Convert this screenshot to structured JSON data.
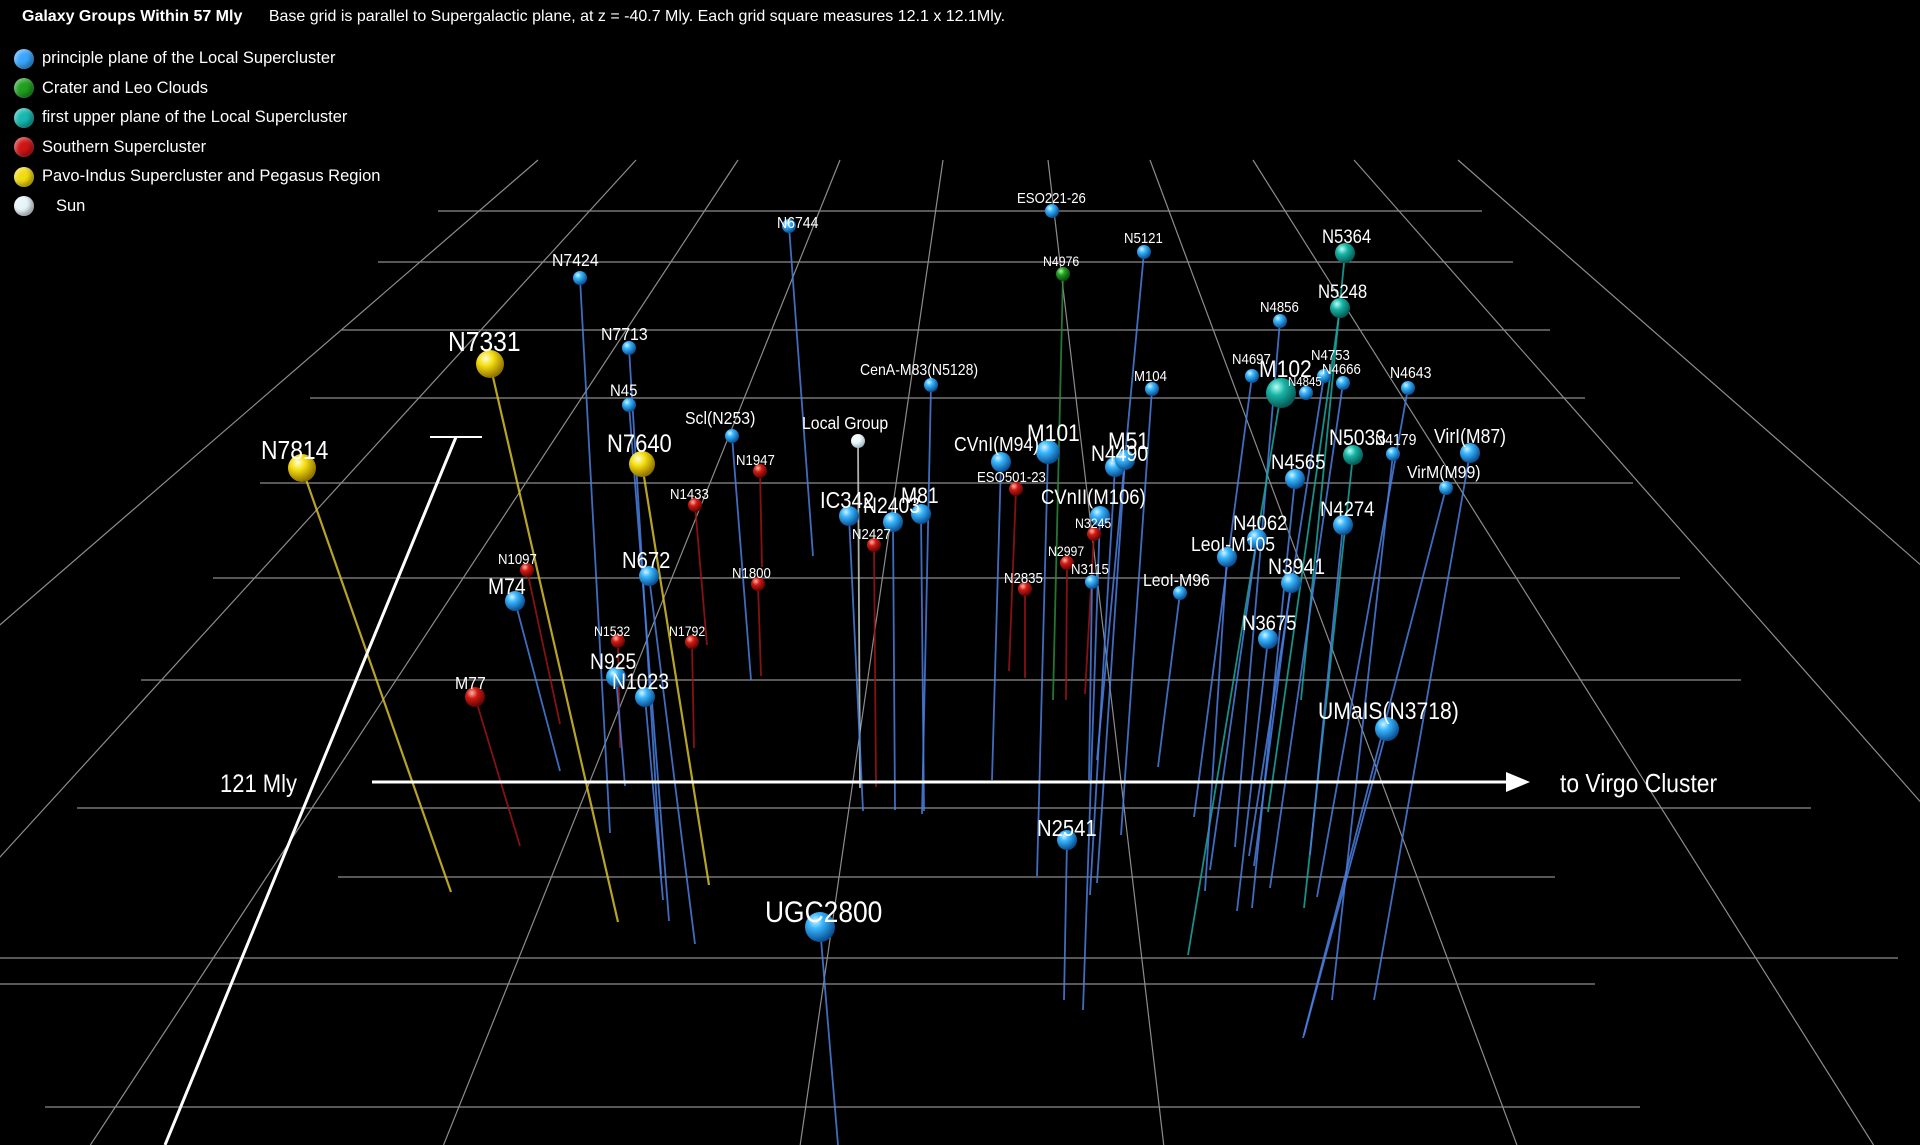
{
  "header": {
    "title": "Galaxy Groups Within 57 Mly",
    "subtitle": "Base grid is parallel to Supergalactic plane, at z = -40.7 Mly. Each grid square measures 12.1 x 12.1Mly."
  },
  "legend": [
    {
      "label": "principle plane of the Local Supercluster",
      "color": "#3aa6ff"
    },
    {
      "label": "Crater and Leo Clouds",
      "color": "#1fa11f"
    },
    {
      "label": "first upper plane of the Local Supercluster",
      "color": "#16b8b0"
    },
    {
      "label": "Southern Supercluster",
      "color": "#d01515"
    },
    {
      "label": "Pavo-Indus Supercluster and Pegasus Region",
      "color": "#f2dc10"
    },
    {
      "label": "Sun",
      "color": "#e8f6fb"
    }
  ],
  "axes": {
    "scale_label": "121 Mly",
    "direction_label": "to Virgo Cluster"
  },
  "galaxies": [
    {
      "name": "N6744",
      "type": "principle",
      "size": "small"
    },
    {
      "name": "ESO221-26",
      "type": "principle",
      "size": "small"
    },
    {
      "name": "N5121",
      "type": "principle",
      "size": "small"
    },
    {
      "name": "N5364",
      "type": "upper",
      "size": "medium"
    },
    {
      "name": "N4976",
      "type": "crater",
      "size": "small"
    },
    {
      "name": "N7424",
      "type": "principle",
      "size": "small"
    },
    {
      "name": "N5248",
      "type": "upper",
      "size": "medium"
    },
    {
      "name": "N4856",
      "type": "principle",
      "size": "small"
    },
    {
      "name": "N7713",
      "type": "principle",
      "size": "small"
    },
    {
      "name": "N7331",
      "type": "pavo",
      "size": "large"
    },
    {
      "name": "CenA-M83(N5128)",
      "type": "principle",
      "size": "small"
    },
    {
      "name": "N4697",
      "type": "principle",
      "size": "small"
    },
    {
      "name": "M102",
      "type": "upper",
      "size": "large"
    },
    {
      "name": "N4753",
      "type": "principle",
      "size": "small"
    },
    {
      "name": "N4643",
      "type": "principle",
      "size": "small"
    },
    {
      "name": "M104",
      "type": "principle",
      "size": "small"
    },
    {
      "name": "N45",
      "type": "principle",
      "size": "small"
    },
    {
      "name": "N4666",
      "type": "principle",
      "size": "small"
    },
    {
      "name": "N4845",
      "type": "principle",
      "size": "small"
    },
    {
      "name": "Scl(N253)",
      "type": "principle",
      "size": "small"
    },
    {
      "name": "Local Group",
      "type": "sun",
      "size": "small"
    },
    {
      "name": "N7814",
      "type": "pavo",
      "size": "large"
    },
    {
      "name": "N7640",
      "type": "pavo",
      "size": "large"
    },
    {
      "name": "CVnI(M94)",
      "type": "principle",
      "size": "medium"
    },
    {
      "name": "M101",
      "type": "principle",
      "size": "medium"
    },
    {
      "name": "N4490",
      "type": "principle",
      "size": "medium"
    },
    {
      "name": "M51",
      "type": "principle",
      "size": "medium"
    },
    {
      "name": "N5033",
      "type": "upper",
      "size": "medium"
    },
    {
      "name": "N4179",
      "type": "principle",
      "size": "small"
    },
    {
      "name": "VirI(M87)",
      "type": "principle",
      "size": "medium"
    },
    {
      "name": "N1947",
      "type": "southern",
      "size": "small"
    },
    {
      "name": "ESO501-23",
      "type": "southern",
      "size": "small"
    },
    {
      "name": "N4565",
      "type": "principle",
      "size": "medium"
    },
    {
      "name": "VirM(M99)",
      "type": "principle",
      "size": "small"
    },
    {
      "name": "N1433",
      "type": "southern",
      "size": "small"
    },
    {
      "name": "IC342",
      "type": "principle",
      "size": "medium"
    },
    {
      "name": "N2403",
      "type": "principle",
      "size": "medium"
    },
    {
      "name": "M81",
      "type": "principle",
      "size": "medium"
    },
    {
      "name": "CVnII(M106)",
      "type": "principle",
      "size": "medium"
    },
    {
      "name": "N4274",
      "type": "principle",
      "size": "medium"
    },
    {
      "name": "N2427",
      "type": "southern",
      "size": "small"
    },
    {
      "name": "N3245",
      "type": "southern",
      "size": "small"
    },
    {
      "name": "N4062",
      "type": "principle",
      "size": "medium"
    },
    {
      "name": "LeoI-M105",
      "type": "principle",
      "size": "medium"
    },
    {
      "name": "N1097",
      "type": "southern",
      "size": "small"
    },
    {
      "name": "N672",
      "type": "principle",
      "size": "medium"
    },
    {
      "name": "N2997",
      "type": "southern",
      "size": "small"
    },
    {
      "name": "N1800",
      "type": "southern",
      "size": "small"
    },
    {
      "name": "N3115",
      "type": "principle",
      "size": "small"
    },
    {
      "name": "N3941",
      "type": "principle",
      "size": "medium"
    },
    {
      "name": "N2835",
      "type": "southern",
      "size": "small"
    },
    {
      "name": "LeoI-M96",
      "type": "principle",
      "size": "small"
    },
    {
      "name": "M74",
      "type": "principle",
      "size": "medium"
    },
    {
      "name": "N3675",
      "type": "principle",
      "size": "medium"
    },
    {
      "name": "N1532",
      "type": "southern",
      "size": "small"
    },
    {
      "name": "N1792",
      "type": "southern",
      "size": "small"
    },
    {
      "name": "N925",
      "type": "principle",
      "size": "medium"
    },
    {
      "name": "N1023",
      "type": "principle",
      "size": "medium"
    },
    {
      "name": "M77",
      "type": "southern",
      "size": "medium"
    },
    {
      "name": "UMaIS(N3718)",
      "type": "principle",
      "size": "medium"
    },
    {
      "name": "N2541",
      "type": "principle",
      "size": "medium"
    },
    {
      "name": "UGC2800",
      "type": "principle",
      "size": "large"
    }
  ]
}
